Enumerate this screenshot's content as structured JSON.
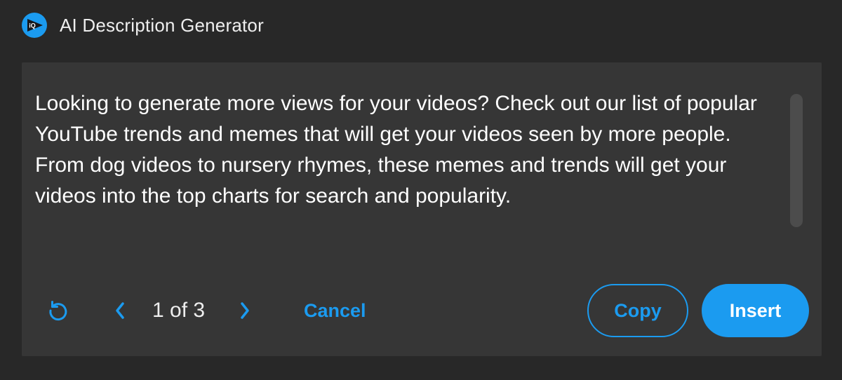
{
  "header": {
    "logo_text": "iQ",
    "title": "AI Description Generator"
  },
  "content": {
    "description": "Looking to generate more views for your videos? Check out our list of popular YouTube trends and memes that will get your videos seen by more people. From dog videos to nursery rhymes, these memes and trends will get your videos into the top charts for search and popularity."
  },
  "toolbar": {
    "regenerate_icon": "refresh-icon",
    "prev_icon": "chevron-left-icon",
    "next_icon": "chevron-right-icon",
    "pager_text": "1 of 3",
    "cancel_label": "Cancel",
    "copy_label": "Copy",
    "insert_label": "Insert"
  },
  "colors": {
    "background": "#282828",
    "panel": "#363636",
    "accent": "#1b9bf0",
    "text": "#ffffff"
  }
}
